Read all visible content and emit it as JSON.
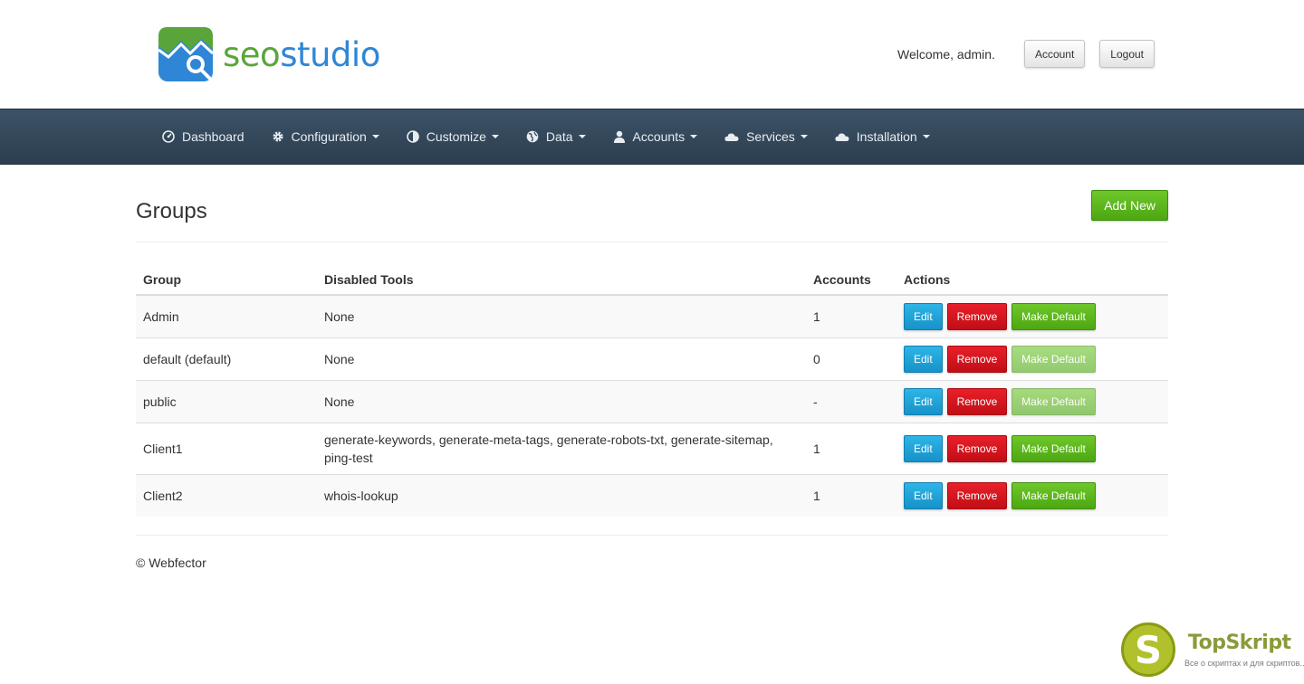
{
  "header": {
    "logo_seo": "seo",
    "logo_studio": "studio",
    "welcome": "Welcome, admin.",
    "account_label": "Account",
    "logout_label": "Logout"
  },
  "nav": {
    "items": [
      {
        "label": "Dashboard",
        "icon": "dashboard-icon",
        "dropdown": false
      },
      {
        "label": "Configuration",
        "icon": "gear-icon",
        "dropdown": true
      },
      {
        "label": "Customize",
        "icon": "contrast-icon",
        "dropdown": true
      },
      {
        "label": "Data",
        "icon": "globe-icon",
        "dropdown": true
      },
      {
        "label": "Accounts",
        "icon": "user-icon",
        "dropdown": true
      },
      {
        "label": "Services",
        "icon": "cloud-icon",
        "dropdown": true
      },
      {
        "label": "Installation",
        "icon": "cloud-icon",
        "dropdown": true
      }
    ]
  },
  "page": {
    "title": "Groups",
    "add_new_label": "Add New"
  },
  "table": {
    "headers": [
      "Group",
      "Disabled Tools",
      "Accounts",
      "Actions"
    ],
    "actions": {
      "edit": "Edit",
      "remove": "Remove",
      "make_default": "Make Default"
    },
    "rows": [
      {
        "group": "Admin",
        "tools": "None",
        "accounts": "1",
        "default_disabled": false
      },
      {
        "group": "default (default)",
        "tools": "None",
        "accounts": "0",
        "default_disabled": true
      },
      {
        "group": "public",
        "tools": "None",
        "accounts": "-",
        "default_disabled": true
      },
      {
        "group": "Client1",
        "tools": "generate-keywords, generate-meta-tags, generate-robots-txt, generate-sitemap, ping-test",
        "accounts": "1",
        "default_disabled": false
      },
      {
        "group": "Client2",
        "tools": "whois-lookup",
        "accounts": "1",
        "default_disabled": false
      }
    ]
  },
  "footer": {
    "copyright": "© Webfector"
  },
  "watermark": {
    "letter": "S",
    "title": "TopSkript",
    "subtitle": "Все о скриптах и для скриптов..."
  },
  "colors": {
    "navbar": "#2c3e50",
    "green": "#5cb71a",
    "red": "#d3141d",
    "blue": "#1ea3d8"
  }
}
